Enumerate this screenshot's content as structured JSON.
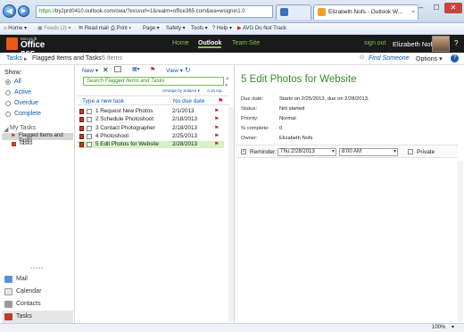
{
  "browser": {
    "back": "◀",
    "forward": "▶",
    "url_scheme": "https://",
    "url_rest": "by2prd0410.outlook.com/owa/?exsvurl=1&realm=office365.com&wa=wsignin1.0",
    "tab1": "Elizabeth Nofs - Outlook W...",
    "tab2": "",
    "minimize": "–",
    "maximize": "☐",
    "close": "✕"
  },
  "commandbar": {
    "home": "Home",
    "feeds": "Feeds (J)",
    "readmail": "Read mail",
    "print": "Print",
    "page": "Page",
    "safety": "Safety",
    "tools": "Tools",
    "help": "Help",
    "dnt": "AVG Do Not Track"
  },
  "header": {
    "ms": "Microsoft",
    "logo": "Office 365",
    "nav": [
      "Home",
      "Outlook",
      "Team Site"
    ],
    "signout": "sign out",
    "user": "Elizabeth Nofs",
    "help": "?"
  },
  "breadcrumb": {
    "root": "Tasks",
    "current": "Flagged Items and Tasks",
    "count": "5 Items",
    "find": "Find Someone",
    "options": "Options",
    "help": "?"
  },
  "left": {
    "show_label": "Show:",
    "filters": [
      "All",
      "Active",
      "Overdue",
      "Complete"
    ],
    "my_tasks": "My Tasks",
    "folders": [
      "Flagged Items and Tasks",
      "Tasks"
    ],
    "dots": "• • • • •",
    "nav": [
      "Mail",
      "Calendar",
      "Contacts",
      "Tasks"
    ]
  },
  "toolbar": {
    "new": "New",
    "view": "View",
    "search_placeholder": "Search Flagged Items and Tasks",
    "arrange": "Arrange by Subject",
    "order": "A on top"
  },
  "list": {
    "type_new": "Type a new task",
    "due_header": "No due date",
    "rows": [
      {
        "name": "1 Request New Photos",
        "date": "2/1/2013"
      },
      {
        "name": "2 Schedule Photoshoot",
        "date": "2/18/2013"
      },
      {
        "name": "3 Contact Photographer",
        "date": "2/18/2013"
      },
      {
        "name": "4 Photoshoot",
        "date": "2/25/2013"
      },
      {
        "name": "5 Edit Photos for Website",
        "date": "2/28/2013"
      }
    ]
  },
  "detail": {
    "title": "5 Edit Photos for Website",
    "labels": [
      "Due date:",
      "Status:",
      "Priority:",
      "% complete:",
      "Owner:"
    ],
    "values": [
      "Starts on 2/25/2013, due on 2/28/2013.",
      "Not started",
      "Normal",
      "0",
      "Elizabeth Nofs"
    ],
    "reminder_label": "Reminder:",
    "reminder_date": "Thu 2/28/2013",
    "reminder_time": "8:00 AM",
    "private": "Private"
  },
  "status": {
    "zoom": "100%"
  },
  "colors": {
    "accent_green": "#7fc24b",
    "link_blue": "#0b5aa8",
    "flag_red": "#c8231b",
    "header_black": "#1a1a1a"
  }
}
